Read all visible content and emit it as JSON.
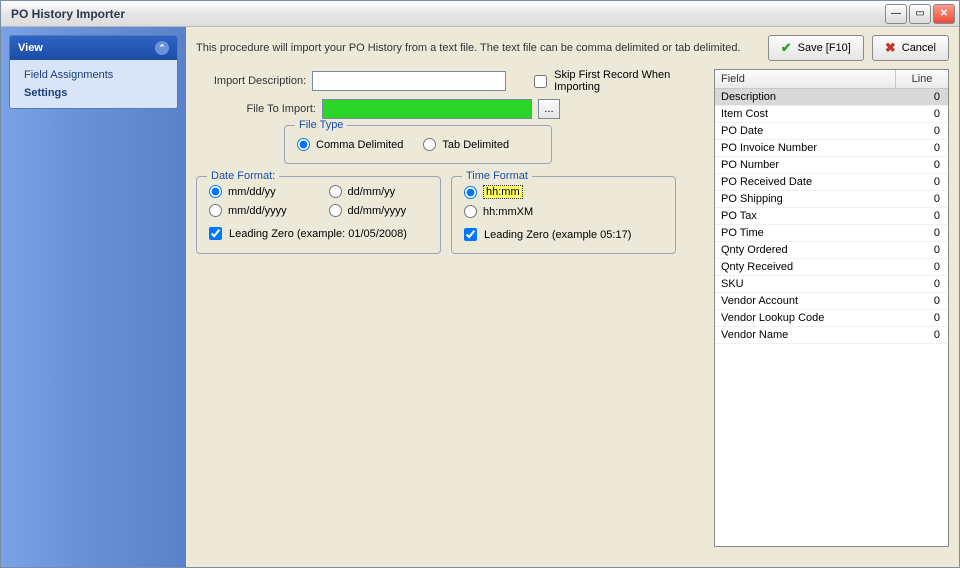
{
  "window": {
    "title": "PO History Importer"
  },
  "sidebar": {
    "header": "View",
    "items": [
      {
        "label": "Field Assignments"
      },
      {
        "label": "Settings"
      }
    ]
  },
  "intro": "This procedure will import your PO History from a text file.  The text file can be comma delimited or tab delimited.",
  "buttons": {
    "save": "Save [F10]",
    "cancel": "Cancel"
  },
  "form": {
    "import_desc_label": "Import Description:",
    "import_desc_value": "",
    "file_label": "File To Import:",
    "file_value": "",
    "browse": "...",
    "skip_first": "Skip First Record When Importing",
    "skip_first_checked": false,
    "filetype_legend": "File Type",
    "filetype_options": [
      "Comma Delimited",
      "Tab Delimited"
    ],
    "filetype_selected": 0
  },
  "date_format": {
    "legend": "Date Format:",
    "options": [
      "mm/dd/yy",
      "dd/mm/yy",
      "mm/dd/yyyy",
      "dd/mm/yyyy"
    ],
    "selected": 0,
    "leading_zero_label": "Leading Zero (example: 01/05/2008)",
    "leading_zero_checked": true
  },
  "time_format": {
    "legend": "Time Format",
    "options": [
      "hh:mm",
      "hh:mmXM"
    ],
    "selected": 0,
    "leading_zero_label": "Leading Zero (example 05:17)",
    "leading_zero_checked": true
  },
  "table": {
    "headers": {
      "field": "Field",
      "line": "Line"
    },
    "rows": [
      {
        "field": "Description",
        "line": "0",
        "selected": true
      },
      {
        "field": "Item Cost",
        "line": "0"
      },
      {
        "field": "PO Date",
        "line": "0"
      },
      {
        "field": "PO Invoice Number",
        "line": "0"
      },
      {
        "field": "PO Number",
        "line": "0"
      },
      {
        "field": "PO Received Date",
        "line": "0"
      },
      {
        "field": "PO Shipping",
        "line": "0"
      },
      {
        "field": "PO Tax",
        "line": "0"
      },
      {
        "field": "PO Time",
        "line": "0"
      },
      {
        "field": "Qnty Ordered",
        "line": "0"
      },
      {
        "field": "Qnty Received",
        "line": "0"
      },
      {
        "field": "SKU",
        "line": "0"
      },
      {
        "field": "Vendor Account",
        "line": "0"
      },
      {
        "field": "Vendor Lookup Code",
        "line": "0"
      },
      {
        "field": "Vendor Name",
        "line": "0"
      }
    ]
  }
}
